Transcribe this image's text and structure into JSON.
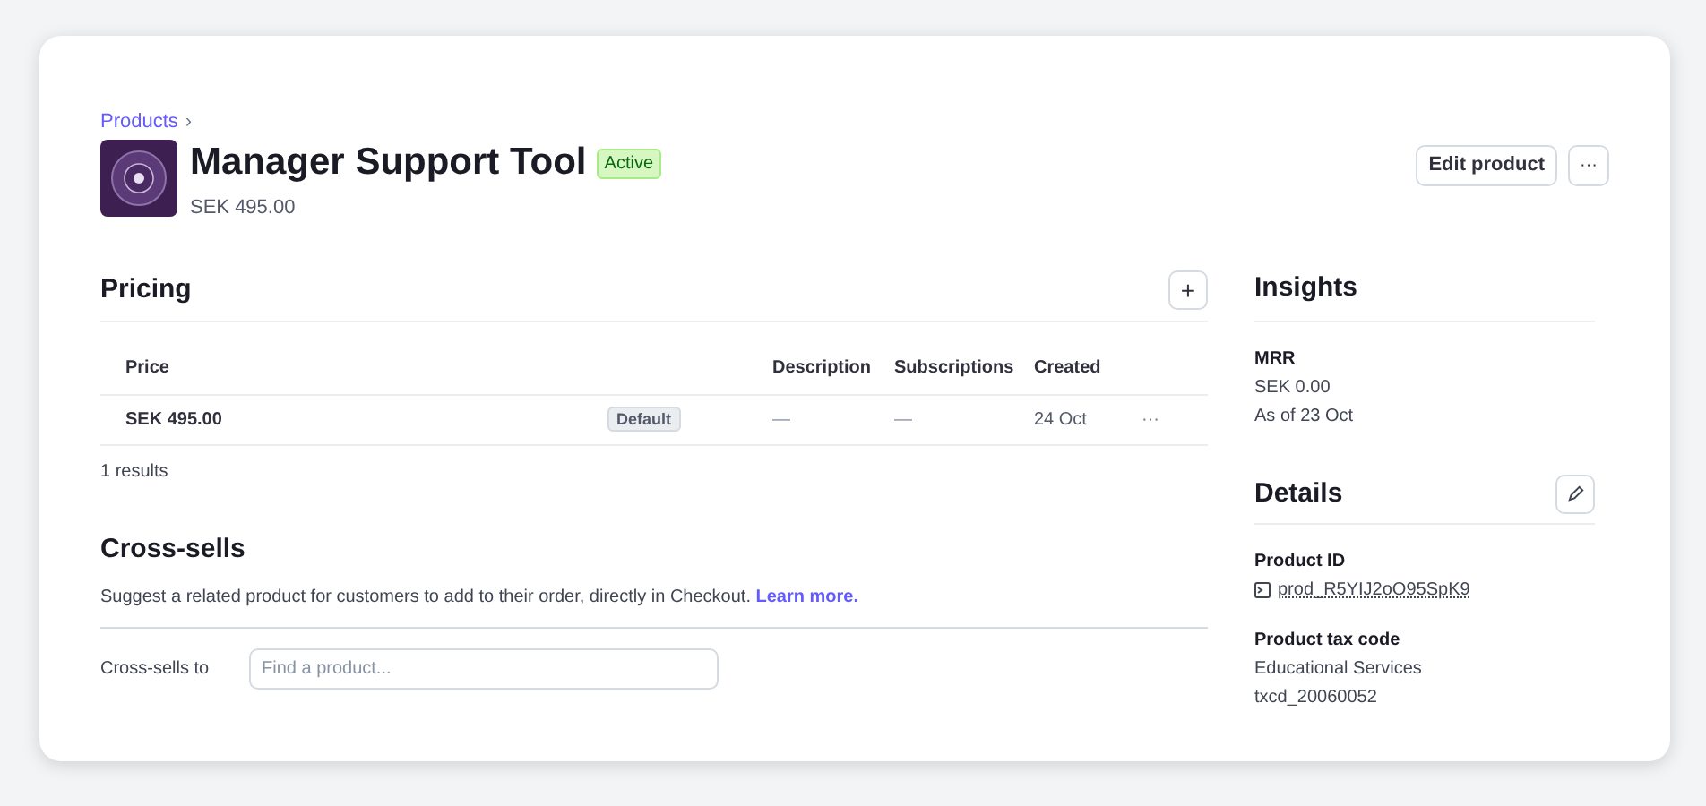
{
  "breadcrumb": {
    "label": "Products",
    "separator": "›"
  },
  "product": {
    "name": "Manager Support Tool",
    "status": "Active",
    "price": "SEK 495.00"
  },
  "actions": {
    "edit": "Edit product",
    "more": "···"
  },
  "pricing": {
    "title": "Pricing",
    "add": "+",
    "columns": [
      "Price",
      "",
      "Description",
      "Subscriptions",
      "Created",
      ""
    ],
    "rows": [
      {
        "price": "SEK 495.00",
        "badge": "Default",
        "description": "—",
        "subscriptions": "—",
        "created": "24 Oct",
        "menu": "···"
      }
    ],
    "results": "1 results"
  },
  "cross_sells": {
    "title": "Cross-sells",
    "description": "Suggest a related product for customers to add to their order, directly in Checkout.",
    "link": "Learn more.",
    "field_label": "Cross-sells to",
    "placeholder": "Find a product..."
  },
  "insights": {
    "title": "Insights",
    "label": "MRR",
    "value": "SEK 0.00",
    "as_of": "As of 23 Oct"
  },
  "details": {
    "title": "Details",
    "fields": [
      {
        "label": "Product ID",
        "values": [
          "prod_R5YIJ2oO95SpK9"
        ],
        "kind": "id"
      },
      {
        "label": "Product tax code",
        "values": [
          "Educational Services",
          "txcd_20060052"
        ],
        "kind": "text"
      }
    ]
  }
}
